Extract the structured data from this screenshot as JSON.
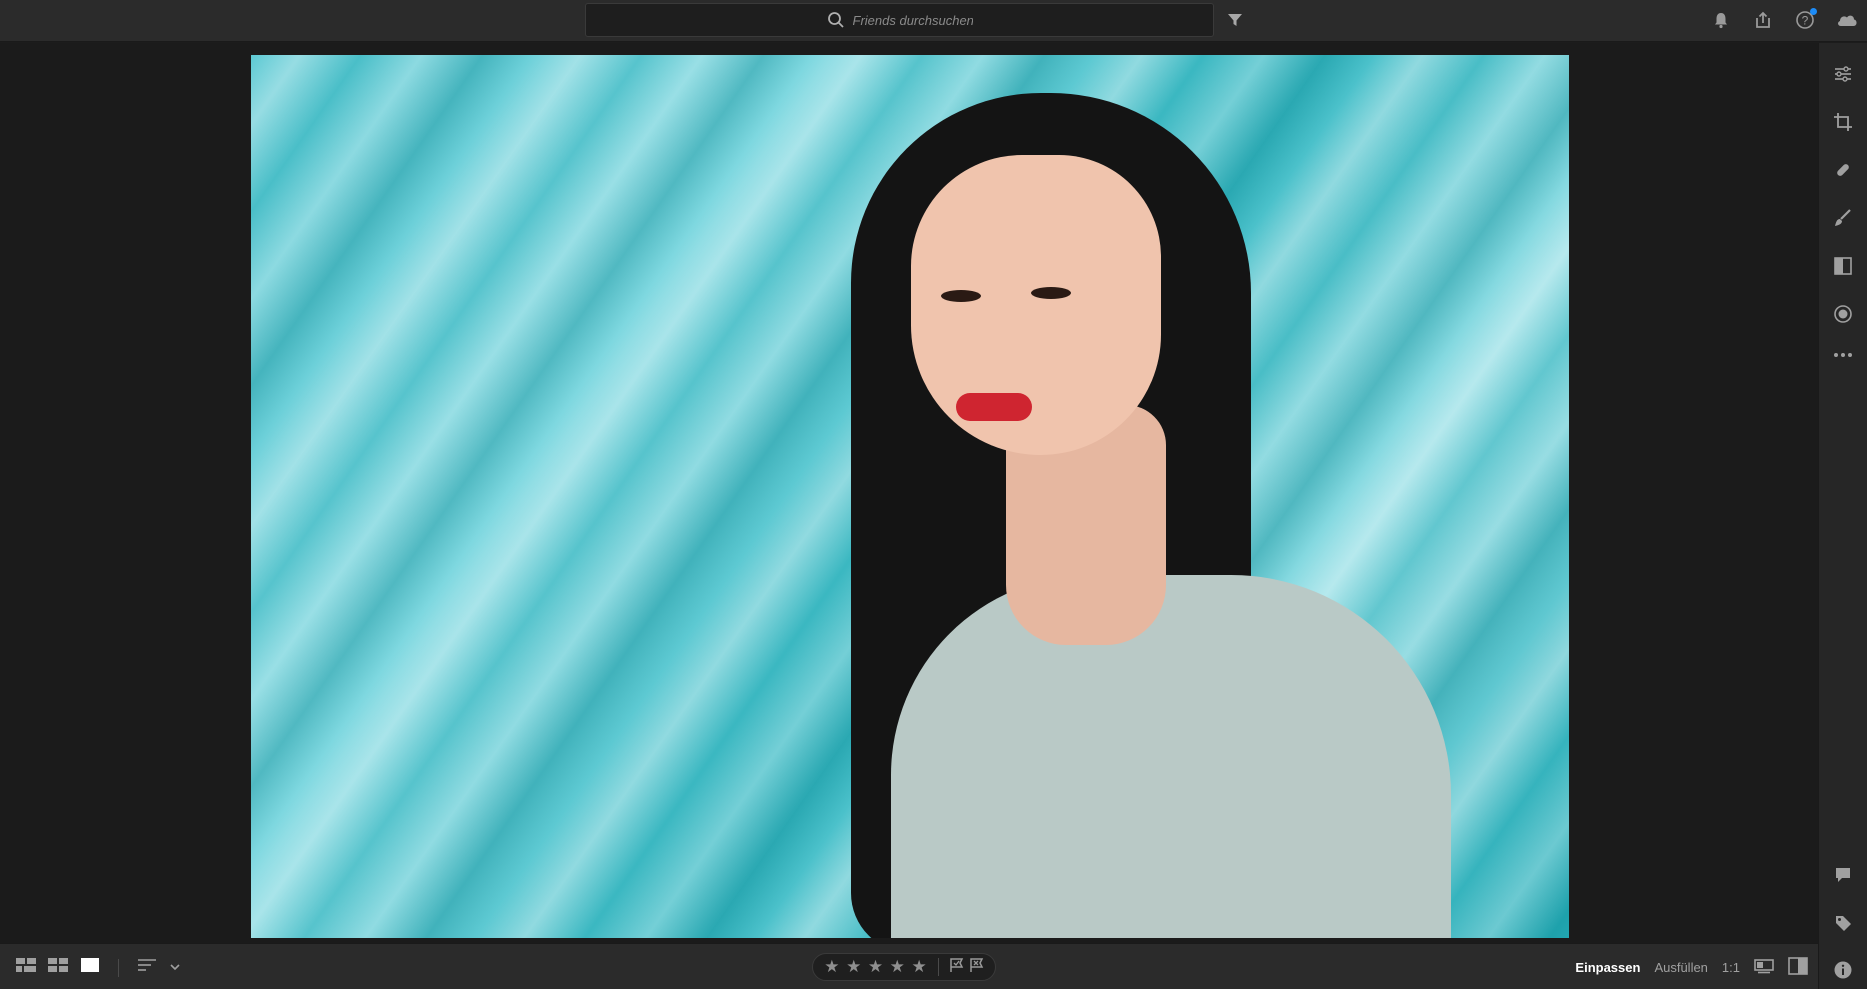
{
  "search": {
    "placeholder": "Friends durchsuchen"
  },
  "top_icons": [
    "bell-icon",
    "share-icon",
    "help-icon",
    "cloud-icon"
  ],
  "right_tools": [
    "edit-sliders-icon",
    "crop-icon",
    "healing-icon",
    "brush-icon",
    "gradient-icon",
    "radial-icon",
    "more-icon",
    "comment-icon",
    "tag-icon",
    "info-icon"
  ],
  "bottom": {
    "view_modes": [
      "grid-large-icon",
      "grid-small-icon",
      "single-view-icon"
    ],
    "rating_stars": [
      "★",
      "★",
      "★",
      "★",
      "★"
    ],
    "zoom_fit": "Einpassen",
    "zoom_fill": "Ausfüllen",
    "zoom_1to1": "1:1"
  },
  "colors": {
    "accent": "#1d8cf8",
    "bg": "#1c1c1c",
    "bar": "#2b2b2b"
  }
}
